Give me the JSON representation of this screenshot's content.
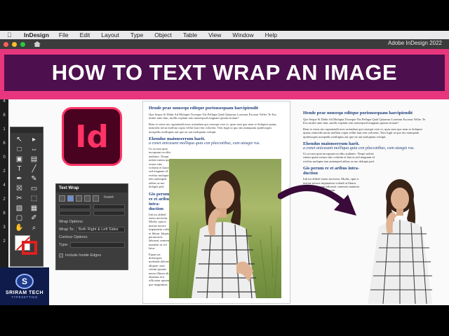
{
  "menubar": {
    "app_name": "InDesign",
    "items": [
      "File",
      "Edit",
      "Layout",
      "Type",
      "Object",
      "Table",
      "View",
      "Window",
      "Help"
    ]
  },
  "titlebar": {
    "window_title": "Adobe InDesign 2022"
  },
  "banner": {
    "title": "HOW TO TEXT WRAP AN IMAGE"
  },
  "ruler": {
    "marks": [
      "4",
      "8",
      "1",
      "6",
      "0",
      "2",
      "4",
      "2",
      "8",
      "3",
      "2"
    ]
  },
  "logo": {
    "text": "Id"
  },
  "text_wrap_panel": {
    "title": "Text Wrap",
    "invert_label": "Invert",
    "wrap_options_label": "Wrap Options:",
    "wrap_to_label": "Wrap To:",
    "wrap_to_value": "Both Right & Left Sides",
    "contour_options_label": "Contour Options:",
    "type_label": "Type:",
    "include_inside_edges": "Include Inside Edges"
  },
  "doc_left": {
    "heading": "Hende prae nonsequ editque porionsequam harcipiendit",
    "para1": "Que Seque Si Debit Ad Molupta Tisseque Nis Pellupa Quid Quiamus Loremut Excatur Vellec Te Eos imitet unto lam, mollis explam rem nonsequod magnam quiam etotaut?",
    "para2": "Rem et venis nis cuptatendit mos aciendam qui conequi vere re, quas sum que nem re dolupter quam, mincidis necat molluta cupta vellut laut rem volorem. Tem fugit ut quo nis numquam quidessquis mospedis molluptas aut que ne aut moluptam volupit.",
    "heading2": "Ehendus maionserrum harit.",
    "sub2": "a conet anicusant molliqua quia con placcatibus, cum utasgiz rus.",
    "para3": "Us accum quia incupsant excilits audiatec. Neqni nobist eatem quant rerum sitis voloitin et harcis sed magnam id evelias molupta tem autemped atibus as mo dolupta ped.",
    "heading3": "Gis perum re et aribus intra-duction",
    "para4": "Iub iur alibeif euem necerem. Modit, opta is nistiae norore imputatem volend ut liburn. Idquis peruncenis laboreat vemenes mantem ut vel latur.",
    "para5": "Equae pe dolorepres molenda dolores aliquae, sunt venim ipsame nemo illitem ali aluamus nos officiatur quiam que magnimus."
  },
  "doc_right": {
    "heading": "Hende prae nonsequ editque porionsequam harcipiendit",
    "para1": "Que Seque Si Debit Ad Molupta Tisseque Nis Pellupa Quid Quiamus Loremut Excatur Vellec Te Eos imitet unto lam, mollis explam rem nonsequod magnam quiam etotaut?",
    "para2": "Rem et venis nis cuptatendit mos aciendam qui conequi vere re, quas sum que nem re dolupter quam, mincidis necat molluta cupta vellut laut rem volorem. Tem fugit ut quo nis numquam quidessquis mospedis molluptas aut que ne aut moluptam volupit.",
    "heading2": "Ehendus maionserrum harit.",
    "sub2": "a conet anicusant molliqua quia con placcatibus, cum utasgiz rus.",
    "para3": "Us accum quia incupsant excilits audiatec. Neqni nobist eatem quant rerum sitis voloitin et harcis sed magnam id evelias molupta tem autemped atibus as mo dolupta ped.",
    "heading3": "Gis perum re et aribus intra-duction",
    "para4": "Iub iur alibeif euem necerem. Modit, opta is nistiae norore imputatem volend ut liburn. Idquis peruncenis laboreat vemenes mantem ut vel latur fugit ulit eum."
  },
  "brand": {
    "mark": "S",
    "name": "SRIRAM TECH",
    "sub": "TYPESETTING"
  },
  "colors": {
    "banner_pink": "#e7367e",
    "banner_purple": "#4e0f4e",
    "indesign_pink": "#ff3366",
    "doc_heading_blue": "#1f3e7a",
    "arrow": "#3a0a3a"
  },
  "icons": [
    "apple-icon",
    "home-icon",
    "selection-tool-icon",
    "direct-selection-icon",
    "type-tool-icon",
    "pen-tool-icon",
    "rectangle-frame-icon",
    "hand-tool-icon",
    "zoom-tool-icon",
    "curved-arrow-icon"
  ]
}
